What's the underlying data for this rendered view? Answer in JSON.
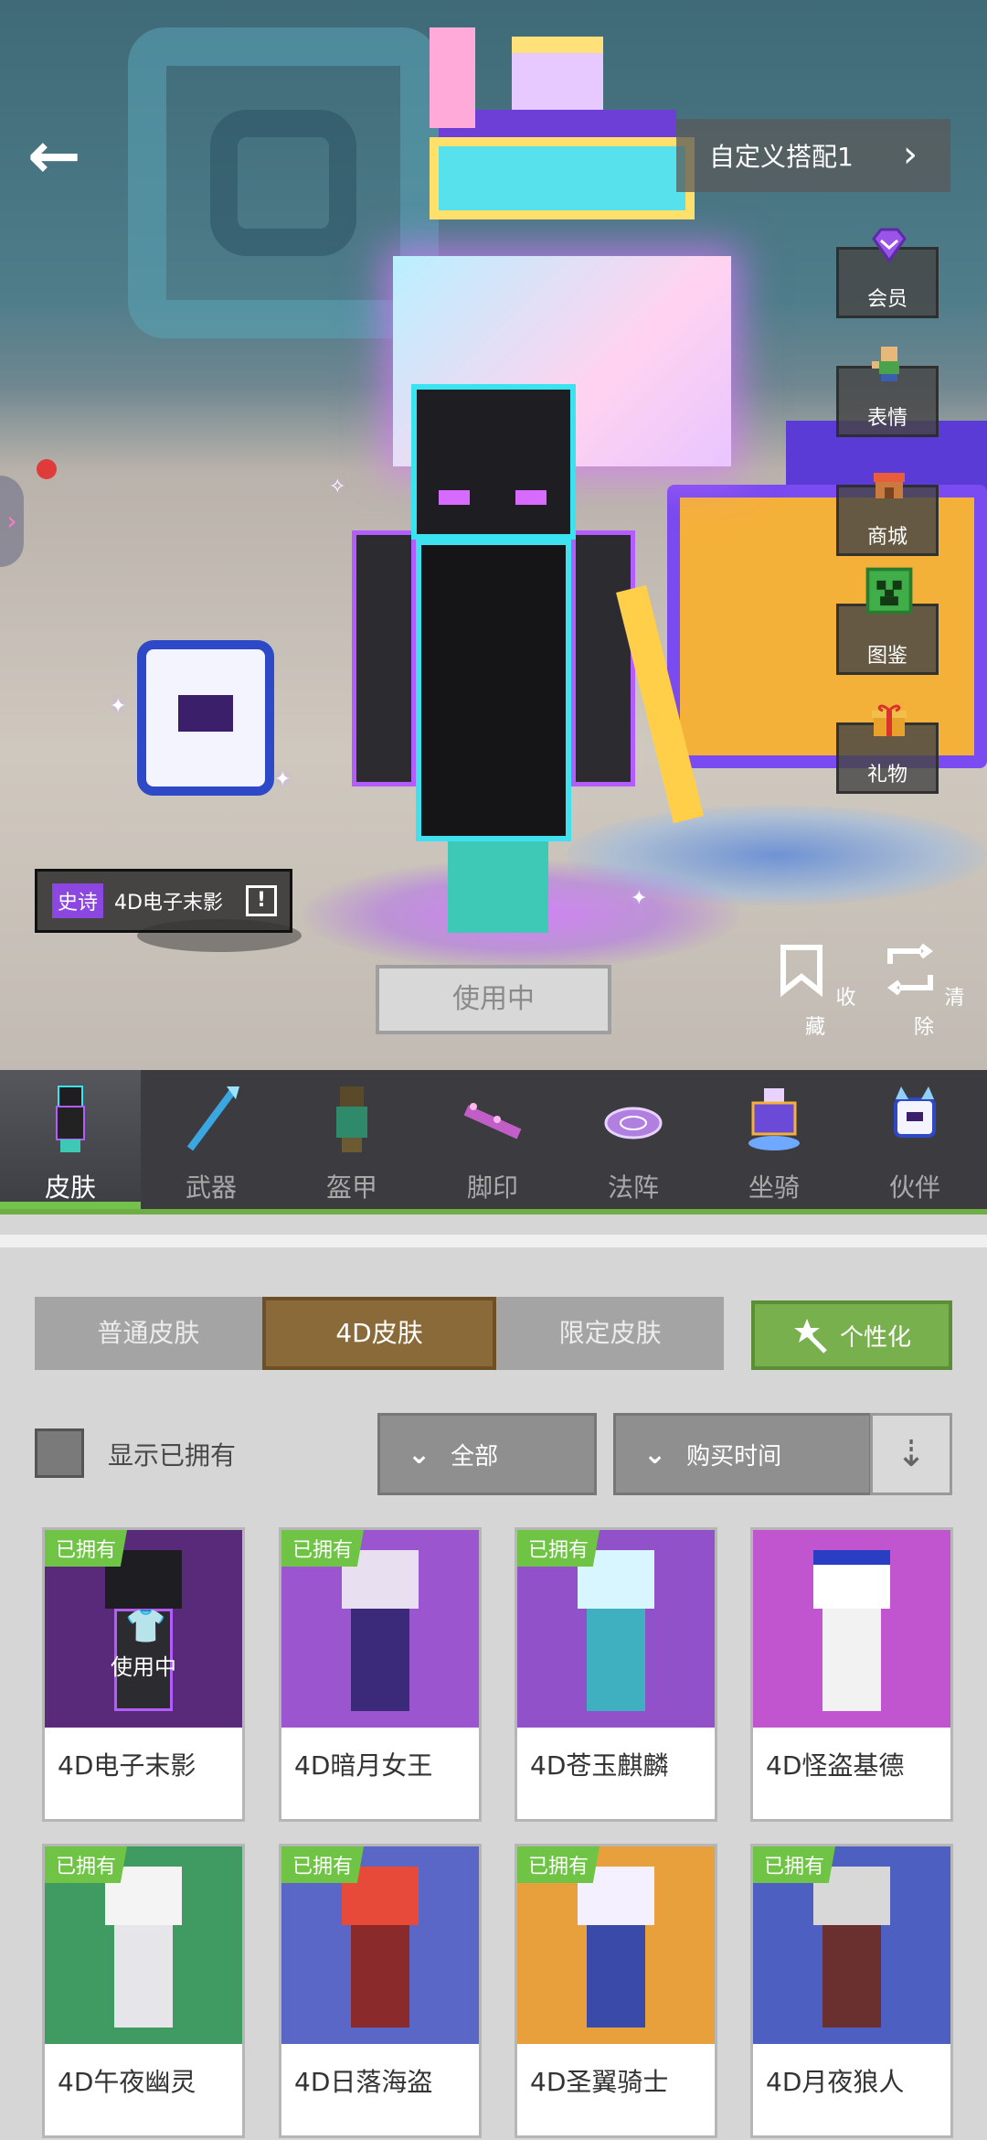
{
  "header": {
    "back_icon": "arrow-left-icon",
    "outfit_label": "自定义搭配1",
    "outfit_chevron": "chevron-right-icon"
  },
  "side_menu": [
    {
      "label": "会员",
      "icon": "gem-icon",
      "color": "#8b47e0"
    },
    {
      "label": "表情",
      "icon": "emote-icon",
      "color": "#4aa34a"
    },
    {
      "label": "商城",
      "icon": "shop-icon",
      "color": "#e0803a"
    },
    {
      "label": "图鉴",
      "icon": "creeper-icon",
      "color": "#3fae48"
    },
    {
      "label": "礼物",
      "icon": "gift-icon",
      "color": "#e8a22b"
    }
  ],
  "preview": {
    "rarity": "史诗",
    "skin_name": "4D电子末影",
    "in_use_label": "使用中",
    "favorite_label": "收藏",
    "clear_label": "清除"
  },
  "categories": [
    {
      "label": "皮肤",
      "active": true
    },
    {
      "label": "武器",
      "active": false
    },
    {
      "label": "盔甲",
      "active": false
    },
    {
      "label": "脚印",
      "active": false
    },
    {
      "label": "法阵",
      "active": false
    },
    {
      "label": "坐骑",
      "active": false
    },
    {
      "label": "伙伴",
      "active": false
    }
  ],
  "filters": {
    "segments": [
      "普通皮肤",
      "4D皮肤",
      "限定皮肤"
    ],
    "active_segment": "4D皮肤",
    "personalize_label": "个性化",
    "show_owned_label": "显示已拥有",
    "show_owned_checked": false,
    "range_dropdown": "全部",
    "sort_dropdown": "购买时间"
  },
  "skins": [
    {
      "name": "4D电子末影",
      "owned_label": "已拥有",
      "owned": true,
      "in_use": true,
      "in_use_label": "使用中",
      "bg": "#5a2a7a"
    },
    {
      "name": "4D暗月女王",
      "owned_label": "已拥有",
      "owned": true,
      "in_use": false,
      "bg": "#9a55cf"
    },
    {
      "name": "4D苍玉麒麟",
      "owned_label": "已拥有",
      "owned": true,
      "in_use": false,
      "bg": "#9152c9"
    },
    {
      "name": "4D怪盗基德",
      "owned_label": "",
      "owned": false,
      "in_use": false,
      "bg": "#c154cf"
    },
    {
      "name": "4D午夜幽灵",
      "owned_label": "已拥有",
      "owned": true,
      "in_use": false,
      "bg": "#3f9b62"
    },
    {
      "name": "4D日落海盗",
      "owned_label": "已拥有",
      "owned": true,
      "in_use": false,
      "bg": "#5a67c6"
    },
    {
      "name": "4D圣翼骑士",
      "owned_label": "已拥有",
      "owned": true,
      "in_use": false,
      "bg": "#e8a03d"
    },
    {
      "name": "4D月夜狼人",
      "owned_label": "已拥有",
      "owned": true,
      "in_use": false,
      "bg": "#4d5fc0"
    }
  ]
}
